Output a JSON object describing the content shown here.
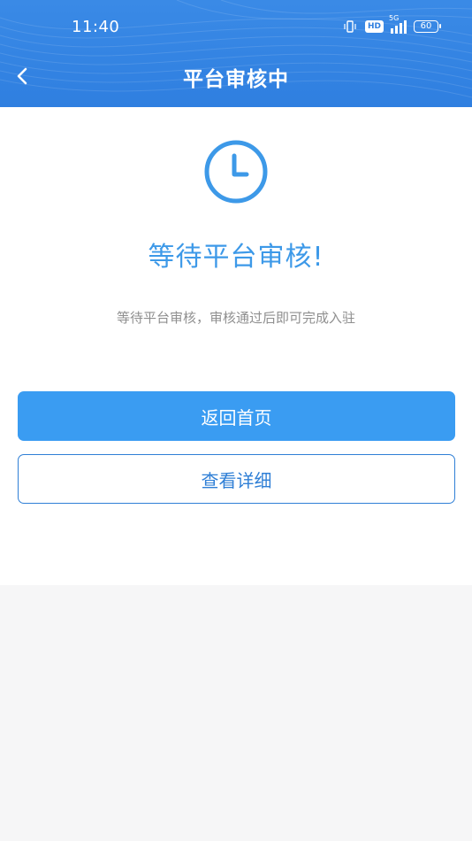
{
  "status_bar": {
    "time": "11:40",
    "hd_label": "HD",
    "network_label": "5G",
    "battery_level": "60"
  },
  "nav": {
    "title": "平台审核中",
    "back_icon": "chevron-left-icon"
  },
  "content": {
    "status_icon": "clock-icon",
    "heading": "等待平台审核!",
    "description": "等待平台审核，审核通过后即可完成入驻"
  },
  "buttons": {
    "home_label": "返回首页",
    "details_label": "查看详细"
  },
  "colors": {
    "header_blue": "#2f7fe0",
    "accent_blue": "#3d99e8",
    "primary_button": "#3a9cf2",
    "outline_button": "#2f7fd6"
  }
}
